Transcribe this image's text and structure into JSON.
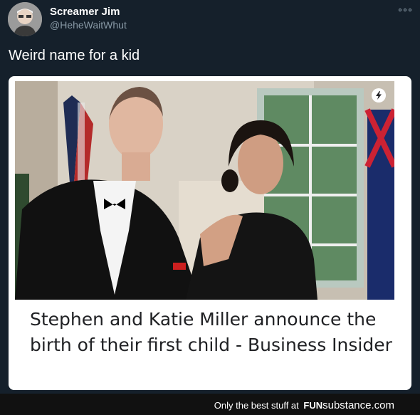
{
  "tweet": {
    "author_name": "Screamer Jim",
    "author_handle": "@HeheWaitWhut",
    "text": "Weird name for a kid",
    "more_icon": "ellipsis-icon"
  },
  "card": {
    "headline": "Stephen and Katie Miller announce the birth of their first child - Business Insider",
    "badge_icon": "lightning-bolt-icon"
  },
  "footer": {
    "tagline": "Only the best stuff at",
    "brand_fun": "FUN",
    "brand_substance": "substance.com"
  },
  "colors": {
    "background": "#15202b",
    "handle": "#8899a6",
    "card": "#ffffff",
    "headline": "#202124",
    "footer": "#111111"
  }
}
